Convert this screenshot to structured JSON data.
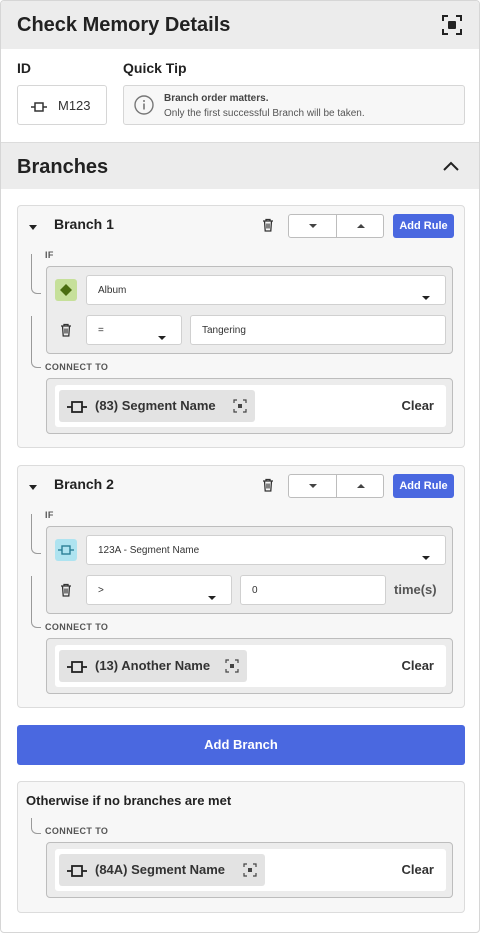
{
  "header": {
    "title": "Check Memory Details",
    "focus_icon": "focus-target-icon"
  },
  "details": {
    "id_label": "ID",
    "id_value": "M123",
    "tip_label": "Quick Tip",
    "tip_line1": "Branch order matters.",
    "tip_line2": "Only the first successful Branch will be taken."
  },
  "branches_section": {
    "title": "Branches",
    "collapse_icon": "chevron-up-icon"
  },
  "common": {
    "add_rule": "Add Rule",
    "if_label": "IF",
    "connect_label": "CONNECT TO",
    "clear_label": "Clear"
  },
  "branches": [
    {
      "name": "Branch 1",
      "condition": {
        "subject": "Album",
        "subject_icon": "diamond-icon",
        "operator": "=",
        "value": "Tangering",
        "suffix": ""
      },
      "connect": "(83) Segment Name"
    },
    {
      "name": "Branch 2",
      "condition": {
        "subject": "123A - Segment Name",
        "subject_icon": "segment-node-icon",
        "operator": ">",
        "value": "0",
        "suffix": "time(s)"
      },
      "connect": "(13) Another Name"
    }
  ],
  "add_branch": "Add Branch",
  "otherwise": {
    "title": "Otherwise if no branches are met",
    "connect": "(84A) Segment Name"
  },
  "colors": {
    "accent": "#4a68e0",
    "diamond_badge": "#c6e09a",
    "segment_badge": "#aee3f0"
  }
}
